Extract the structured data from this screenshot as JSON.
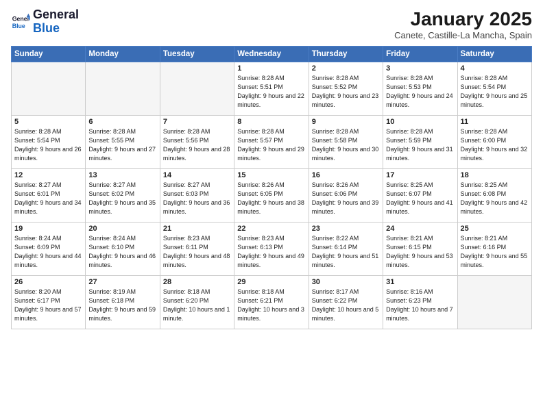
{
  "logo": {
    "text_general": "General",
    "text_blue": "Blue"
  },
  "header": {
    "title": "January 2025",
    "subtitle": "Canete, Castille-La Mancha, Spain"
  },
  "weekdays": [
    "Sunday",
    "Monday",
    "Tuesday",
    "Wednesday",
    "Thursday",
    "Friday",
    "Saturday"
  ],
  "weeks": [
    [
      {
        "day": "",
        "sunrise": "",
        "sunset": "",
        "daylight": "",
        "empty": true
      },
      {
        "day": "",
        "sunrise": "",
        "sunset": "",
        "daylight": "",
        "empty": true
      },
      {
        "day": "",
        "sunrise": "",
        "sunset": "",
        "daylight": "",
        "empty": true
      },
      {
        "day": "1",
        "sunrise": "Sunrise: 8:28 AM",
        "sunset": "Sunset: 5:51 PM",
        "daylight": "Daylight: 9 hours and 22 minutes."
      },
      {
        "day": "2",
        "sunrise": "Sunrise: 8:28 AM",
        "sunset": "Sunset: 5:52 PM",
        "daylight": "Daylight: 9 hours and 23 minutes."
      },
      {
        "day": "3",
        "sunrise": "Sunrise: 8:28 AM",
        "sunset": "Sunset: 5:53 PM",
        "daylight": "Daylight: 9 hours and 24 minutes."
      },
      {
        "day": "4",
        "sunrise": "Sunrise: 8:28 AM",
        "sunset": "Sunset: 5:54 PM",
        "daylight": "Daylight: 9 hours and 25 minutes."
      }
    ],
    [
      {
        "day": "5",
        "sunrise": "Sunrise: 8:28 AM",
        "sunset": "Sunset: 5:54 PM",
        "daylight": "Daylight: 9 hours and 26 minutes."
      },
      {
        "day": "6",
        "sunrise": "Sunrise: 8:28 AM",
        "sunset": "Sunset: 5:55 PM",
        "daylight": "Daylight: 9 hours and 27 minutes."
      },
      {
        "day": "7",
        "sunrise": "Sunrise: 8:28 AM",
        "sunset": "Sunset: 5:56 PM",
        "daylight": "Daylight: 9 hours and 28 minutes."
      },
      {
        "day": "8",
        "sunrise": "Sunrise: 8:28 AM",
        "sunset": "Sunset: 5:57 PM",
        "daylight": "Daylight: 9 hours and 29 minutes."
      },
      {
        "day": "9",
        "sunrise": "Sunrise: 8:28 AM",
        "sunset": "Sunset: 5:58 PM",
        "daylight": "Daylight: 9 hours and 30 minutes."
      },
      {
        "day": "10",
        "sunrise": "Sunrise: 8:28 AM",
        "sunset": "Sunset: 5:59 PM",
        "daylight": "Daylight: 9 hours and 31 minutes."
      },
      {
        "day": "11",
        "sunrise": "Sunrise: 8:28 AM",
        "sunset": "Sunset: 6:00 PM",
        "daylight": "Daylight: 9 hours and 32 minutes."
      }
    ],
    [
      {
        "day": "12",
        "sunrise": "Sunrise: 8:27 AM",
        "sunset": "Sunset: 6:01 PM",
        "daylight": "Daylight: 9 hours and 34 minutes."
      },
      {
        "day": "13",
        "sunrise": "Sunrise: 8:27 AM",
        "sunset": "Sunset: 6:02 PM",
        "daylight": "Daylight: 9 hours and 35 minutes."
      },
      {
        "day": "14",
        "sunrise": "Sunrise: 8:27 AM",
        "sunset": "Sunset: 6:03 PM",
        "daylight": "Daylight: 9 hours and 36 minutes."
      },
      {
        "day": "15",
        "sunrise": "Sunrise: 8:26 AM",
        "sunset": "Sunset: 6:05 PM",
        "daylight": "Daylight: 9 hours and 38 minutes."
      },
      {
        "day": "16",
        "sunrise": "Sunrise: 8:26 AM",
        "sunset": "Sunset: 6:06 PM",
        "daylight": "Daylight: 9 hours and 39 minutes."
      },
      {
        "day": "17",
        "sunrise": "Sunrise: 8:25 AM",
        "sunset": "Sunset: 6:07 PM",
        "daylight": "Daylight: 9 hours and 41 minutes."
      },
      {
        "day": "18",
        "sunrise": "Sunrise: 8:25 AM",
        "sunset": "Sunset: 6:08 PM",
        "daylight": "Daylight: 9 hours and 42 minutes."
      }
    ],
    [
      {
        "day": "19",
        "sunrise": "Sunrise: 8:24 AM",
        "sunset": "Sunset: 6:09 PM",
        "daylight": "Daylight: 9 hours and 44 minutes."
      },
      {
        "day": "20",
        "sunrise": "Sunrise: 8:24 AM",
        "sunset": "Sunset: 6:10 PM",
        "daylight": "Daylight: 9 hours and 46 minutes."
      },
      {
        "day": "21",
        "sunrise": "Sunrise: 8:23 AM",
        "sunset": "Sunset: 6:11 PM",
        "daylight": "Daylight: 9 hours and 48 minutes."
      },
      {
        "day": "22",
        "sunrise": "Sunrise: 8:23 AM",
        "sunset": "Sunset: 6:13 PM",
        "daylight": "Daylight: 9 hours and 49 minutes."
      },
      {
        "day": "23",
        "sunrise": "Sunrise: 8:22 AM",
        "sunset": "Sunset: 6:14 PM",
        "daylight": "Daylight: 9 hours and 51 minutes."
      },
      {
        "day": "24",
        "sunrise": "Sunrise: 8:21 AM",
        "sunset": "Sunset: 6:15 PM",
        "daylight": "Daylight: 9 hours and 53 minutes."
      },
      {
        "day": "25",
        "sunrise": "Sunrise: 8:21 AM",
        "sunset": "Sunset: 6:16 PM",
        "daylight": "Daylight: 9 hours and 55 minutes."
      }
    ],
    [
      {
        "day": "26",
        "sunrise": "Sunrise: 8:20 AM",
        "sunset": "Sunset: 6:17 PM",
        "daylight": "Daylight: 9 hours and 57 minutes."
      },
      {
        "day": "27",
        "sunrise": "Sunrise: 8:19 AM",
        "sunset": "Sunset: 6:18 PM",
        "daylight": "Daylight: 9 hours and 59 minutes."
      },
      {
        "day": "28",
        "sunrise": "Sunrise: 8:18 AM",
        "sunset": "Sunset: 6:20 PM",
        "daylight": "Daylight: 10 hours and 1 minute."
      },
      {
        "day": "29",
        "sunrise": "Sunrise: 8:18 AM",
        "sunset": "Sunset: 6:21 PM",
        "daylight": "Daylight: 10 hours and 3 minutes."
      },
      {
        "day": "30",
        "sunrise": "Sunrise: 8:17 AM",
        "sunset": "Sunset: 6:22 PM",
        "daylight": "Daylight: 10 hours and 5 minutes."
      },
      {
        "day": "31",
        "sunrise": "Sunrise: 8:16 AM",
        "sunset": "Sunset: 6:23 PM",
        "daylight": "Daylight: 10 hours and 7 minutes."
      },
      {
        "day": "",
        "sunrise": "",
        "sunset": "",
        "daylight": "",
        "empty": true
      }
    ]
  ]
}
